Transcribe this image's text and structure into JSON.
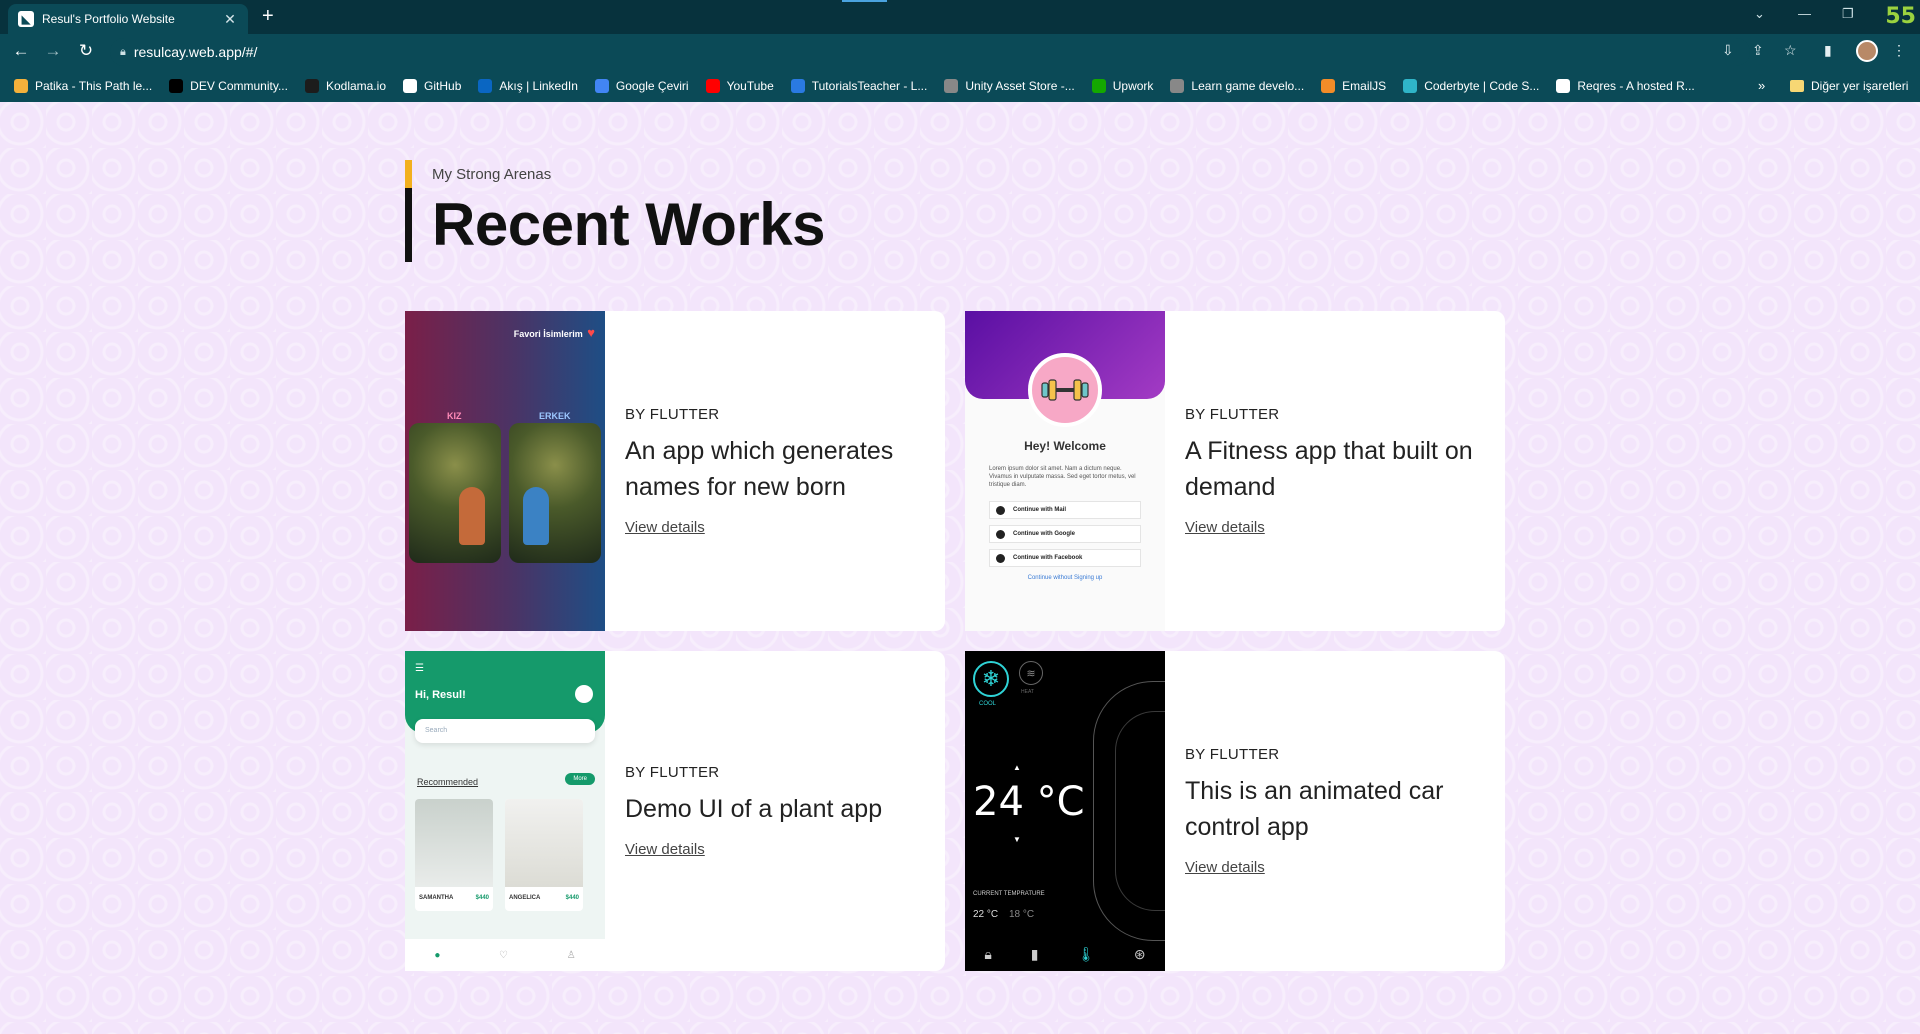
{
  "browser": {
    "tab_title": "Resul's Portfolio Website",
    "tab_close": "✕",
    "new_tab": "+",
    "counter": "55",
    "url": "resulcay.web.app/#/",
    "bookmarks": [
      {
        "label": "Patika - This Path le...",
        "icon": "patika-icon",
        "color": "#f4b13b"
      },
      {
        "label": "DEV Community...",
        "icon": "dev-icon",
        "color": "#000000"
      },
      {
        "label": "Kodlama.io",
        "icon": "kodlama-icon",
        "color": "#1c1c1c"
      },
      {
        "label": "GitHub",
        "icon": "github-icon",
        "color": "#ffffff"
      },
      {
        "label": "Akış | LinkedIn",
        "icon": "linkedin-icon",
        "color": "#0a66c2"
      },
      {
        "label": "Google Çeviri",
        "icon": "translate-icon",
        "color": "#4285f4"
      },
      {
        "label": "YouTube",
        "icon": "youtube-icon",
        "color": "#ff0000"
      },
      {
        "label": "TutorialsTeacher - L...",
        "icon": "tutorialsteacher-icon",
        "color": "#2a7ae2"
      },
      {
        "label": "Unity Asset Store -...",
        "icon": "unity-icon",
        "color": "#888888"
      },
      {
        "label": "Upwork",
        "icon": "upwork-icon",
        "color": "#14a800"
      },
      {
        "label": "Learn game develo...",
        "icon": "unity-learn-icon",
        "color": "#888888"
      },
      {
        "label": "EmailJS",
        "icon": "emailjs-icon",
        "color": "#f28c28"
      },
      {
        "label": "Coderbyte | Code S...",
        "icon": "coderbyte-icon",
        "color": "#2fb5c8"
      },
      {
        "label": "Reqres - A hosted R...",
        "icon": "reqres-icon",
        "color": "#ffffff"
      }
    ],
    "bookmarks_more": "»",
    "other_bookmarks": "Diğer yer işaretleri"
  },
  "section": {
    "eyebrow": "My Strong Arenas",
    "title": "Recent Works",
    "accent_color": "#f2b01e"
  },
  "works": [
    {
      "by": "BY FLUTTER",
      "title": "An app which generates names for new born",
      "link": "View details"
    },
    {
      "by": "BY FLUTTER",
      "title": "A Fitness app that built on demand",
      "link": "View details"
    },
    {
      "by": "BY FLUTTER",
      "title": "Demo UI of a plant app",
      "link": "View details"
    },
    {
      "by": "BY FLUTTER",
      "title": "This is an animated car control app",
      "link": "View details"
    }
  ],
  "thumbs": {
    "names_app": {
      "favorites": "Favori İsimlerim",
      "girl": "KIZ",
      "boy": "ERKEK"
    },
    "fitness_app": {
      "welcome": "Hey! Welcome",
      "lorem": "Lorem ipsum dolor sit amet. Nam a dictum neque. Vivamus in vulputate massa. Sed eget tortor metus, vel tristique diam.",
      "buttons": [
        "Continue with Mail",
        "Continue with Google",
        "Continue with Facebook"
      ],
      "skip": "Continue without Signing up"
    },
    "plant_app": {
      "greeting": "Hi, Resul!",
      "search": "Search",
      "recommended": "Recommended",
      "more": "More",
      "plants": [
        {
          "name": "SAMANTHA",
          "price": "$440"
        },
        {
          "name": "ANGELICA",
          "price": "$440"
        }
      ]
    },
    "car_app": {
      "cool": "COOL",
      "heat": "HEAT",
      "temp": "24 °C",
      "current": "CURRENT TEMPRATURE",
      "inside": "22 °C",
      "outside": "18 °C"
    }
  }
}
